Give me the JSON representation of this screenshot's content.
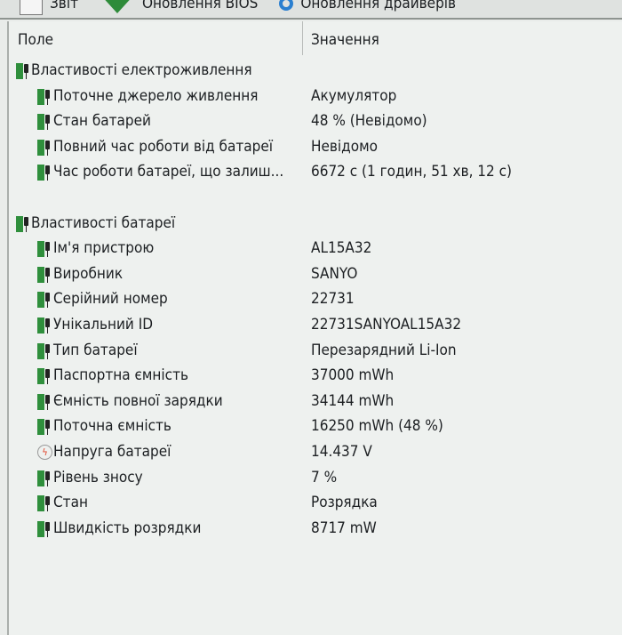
{
  "toolbar": {
    "report": "Звіт",
    "bios_update": "Оновлення BIOS",
    "driver_update": "Оновлення драйверів"
  },
  "header": {
    "field": "Поле",
    "value": "Значення"
  },
  "groups": [
    {
      "title": "Властивості електроживлення",
      "items": [
        {
          "field": "Поточне джерело живлення",
          "value": "Акумулятор"
        },
        {
          "field": "Стан батарей",
          "value": "48 % (Невідомо)"
        },
        {
          "field": "Повний час роботи від батареї",
          "value": "Невідомо"
        },
        {
          "field": "Час роботи батареї, що залиш...",
          "value": "6672 с (1 годин, 51 хв, 12 с)"
        }
      ]
    },
    {
      "title": "Властивості батареї",
      "items": [
        {
          "field": "Ім'я пристрою",
          "value": "AL15A32"
        },
        {
          "field": "Виробник",
          "value": "SANYO"
        },
        {
          "field": "Серійний номер",
          "value": "22731"
        },
        {
          "field": "Унікальний ID",
          "value": "22731SANYOAL15A32"
        },
        {
          "field": "Тип батареї",
          "value": "Перезарядний Li-Ion"
        },
        {
          "field": "Паспортна ємність",
          "value": "37000 mWh"
        },
        {
          "field": "Ємність повної зарядки",
          "value": "34144 mWh"
        },
        {
          "field": "Поточна ємність",
          "value": "16250 mWh  (48 %)"
        },
        {
          "field": "Напруга батареї",
          "value": "14.437 V",
          "icon": "voltage"
        },
        {
          "field": "Рівень зносу",
          "value": "7 %"
        },
        {
          "field": "Стан",
          "value": "Розрядка"
        },
        {
          "field": "Швидкість розрядки",
          "value": "8717 mW"
        }
      ]
    }
  ]
}
